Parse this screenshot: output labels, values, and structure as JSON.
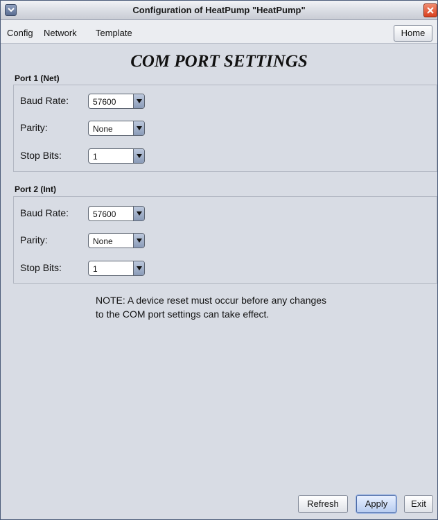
{
  "window": {
    "title": "Configuration of HeatPump \"HeatPump\""
  },
  "menubar": {
    "items": [
      "Config",
      "Network",
      "Template"
    ],
    "home_label": "Home"
  },
  "page_title": "COM PORT SETTINGS",
  "ports": [
    {
      "label": "Port 1 (Net)",
      "baud_rate": {
        "label": "Baud Rate:",
        "value": "57600"
      },
      "parity": {
        "label": "Parity:",
        "value": "None"
      },
      "stop_bits": {
        "label": "Stop Bits:",
        "value": "1"
      }
    },
    {
      "label": "Port 2 (Int)",
      "baud_rate": {
        "label": "Baud Rate:",
        "value": "57600"
      },
      "parity": {
        "label": "Parity:",
        "value": "None"
      },
      "stop_bits": {
        "label": "Stop Bits:",
        "value": "1"
      }
    }
  ],
  "note": {
    "line1": "NOTE: A device reset must occur before any changes",
    "line2": "to the COM port settings can take effect."
  },
  "footer": {
    "refresh_label": "Refresh",
    "apply_label": "Apply",
    "exit_label": "Exit"
  },
  "colors": {
    "background": "#d8dce4",
    "close_button": "#d8401f",
    "accent": "#4a6aa8"
  },
  "icons": {
    "system_menu": "chevron-down-icon",
    "close": "close-icon",
    "combo_arrow": "triangle-down-icon"
  }
}
